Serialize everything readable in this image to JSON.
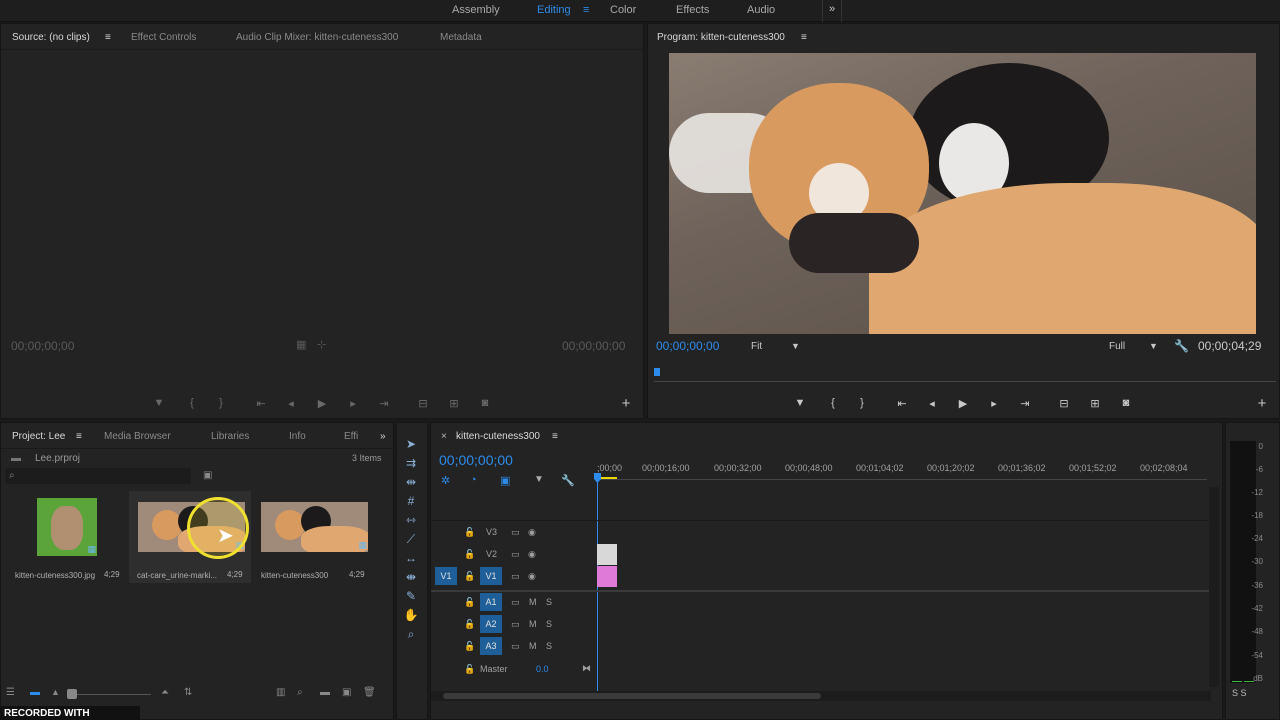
{
  "workspaces": {
    "items": [
      "Assembly",
      "Editing",
      "Color",
      "Effects",
      "Audio"
    ],
    "more": "»"
  },
  "source": {
    "tabs": [
      "Source: (no clips)",
      "Effect Controls",
      "Audio Clip Mixer: kitten-cuteness300",
      "Metadata"
    ],
    "tc_left": "00;00;00;00",
    "tc_right": "00;00;00;00"
  },
  "program": {
    "tab": "Program: kitten-cuteness300",
    "tc_left": "00;00;00;00",
    "fit": "Fit",
    "quality": "Full",
    "tc_right": "00;00;04;29"
  },
  "project": {
    "tabs": [
      "Project: Lee",
      "Media Browser",
      "Libraries",
      "Info",
      "Effi"
    ],
    "file": "Lee.prproj",
    "count": "3 Items",
    "items": [
      {
        "name": "kitten-cuteness300.jpg",
        "dur": "4;29"
      },
      {
        "name": "cat-care_urine-marki...",
        "dur": "4;29"
      },
      {
        "name": "kitten-cuteness300",
        "dur": "4;29"
      }
    ]
  },
  "timeline": {
    "tab": "kitten-cuteness300",
    "tc": "00;00;00;00",
    "ruler": [
      ";00;00",
      "00;00;16;00",
      "00;00;32;00",
      "00;00;48;00",
      "00;01;04;02",
      "00;01;20;02",
      "00;01;36;02",
      "00;01;52;02",
      "00;02;08;04"
    ],
    "video_tracks": [
      "V3",
      "V2",
      "V1"
    ],
    "src_v": "V1",
    "audio_tracks": [
      "A1",
      "A2",
      "A3"
    ],
    "m": "M",
    "s": "S",
    "master": "Master",
    "master_val": "0.0"
  },
  "meter": {
    "labels": [
      "0",
      "-6",
      "-12",
      "-18",
      "-24",
      "-30",
      "-36",
      "-42",
      "-48",
      "-54",
      "dB"
    ],
    "ss": "S S"
  },
  "watermark": "RECORDED WITH",
  "colors": {
    "accent": "#2d8ceb",
    "clip_v2": "#d8d8d8",
    "clip_v1": "#e07ad8"
  }
}
